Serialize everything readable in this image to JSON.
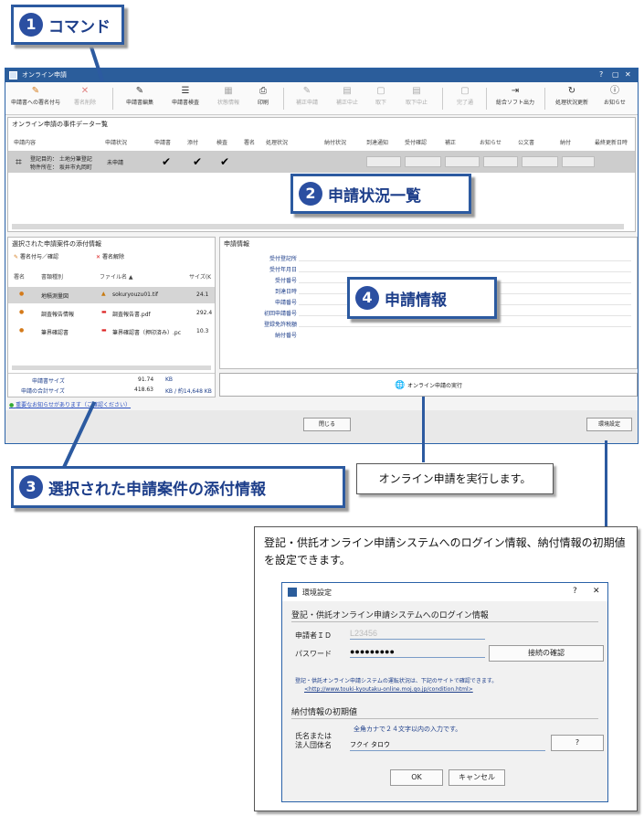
{
  "callouts": {
    "c1": {
      "num": "1",
      "label": "コマンド"
    },
    "c2": {
      "num": "2",
      "label": "申請状況一覧"
    },
    "c3": {
      "num": "3",
      "label": "選択された申請案件の添付情報"
    },
    "c4": {
      "num": "4",
      "label": "申請情報"
    }
  },
  "exec_note": "オンライン申請を実行します。",
  "settings_note": "登記・供託オンライン申請システムへのログイン情報、納付情報の初期値を設定できます。",
  "window": {
    "title": "オンライン申請",
    "controls": [
      "?",
      "▢",
      "✕"
    ],
    "toolbar": [
      {
        "label": "申請書への署名付与",
        "glyph": "✎",
        "enabled": true
      },
      {
        "label": "署名削除",
        "glyph": "✕",
        "enabled": false
      },
      {
        "label": "申請書編集",
        "glyph": "✎",
        "enabled": true
      },
      {
        "label": "申請書検査",
        "glyph": "☰",
        "enabled": true
      },
      {
        "label": "状態情報",
        "glyph": "▦",
        "enabled": false
      },
      {
        "label": "印刷",
        "glyph": "⎙",
        "enabled": true
      },
      {
        "label": "補正申請",
        "glyph": "✎",
        "enabled": false
      },
      {
        "label": "補正中止",
        "glyph": "▤",
        "enabled": false
      },
      {
        "label": "取下",
        "glyph": "▢",
        "enabled": false
      },
      {
        "label": "取下中止",
        "glyph": "▤",
        "enabled": false
      },
      {
        "label": "完了通",
        "glyph": "▢",
        "enabled": false
      },
      {
        "label": "総合ソフト出力",
        "glyph": "⇥",
        "enabled": true
      },
      {
        "label": "処理状況更新",
        "glyph": "↻",
        "enabled": true
      },
      {
        "label": "お知らせ",
        "glyph": "ⓘ",
        "enabled": true
      }
    ],
    "case_list": {
      "title": "オンライン申請の事件データー覧",
      "headers": [
        "申請内容",
        "申請状況",
        "申請書",
        "添付",
        "検査",
        "署名",
        "処理状況",
        "納付状況",
        "到達通知",
        "受付確認",
        "補正",
        "お知らせ",
        "公文書",
        "納付",
        "最終更新日時"
      ],
      "row": {
        "line1": "登記目的： 土地分筆登記",
        "line2": "物件所在： 坂井市丸岡町",
        "status": "未申請",
        "checks": [
          "✔",
          "✔",
          "✔"
        ]
      }
    },
    "attachments": {
      "title": "選択された申請案件の添付情報",
      "sign_button": "署名付与／確認",
      "unsign_button": "署名解除",
      "headers": [
        "署名",
        "書類種別",
        "ファイル名 ▲",
        "サイズ(K"
      ],
      "rows": [
        {
          "type": "地積測量図",
          "file": "sokuryouzu01.tif",
          "size": "24.1"
        },
        {
          "type": "調査報告情報",
          "file": "調査報告書.pdf",
          "size": "292.4"
        },
        {
          "type": "筆界確認書",
          "file": "筆界確認書（押印済み）.pc",
          "size": "10.3"
        }
      ],
      "summary": [
        {
          "label": "申請書サイズ",
          "value": "91.74",
          "unit": "KB"
        },
        {
          "label": "申請の合計サイズ",
          "value": "418.63",
          "unit": "KB / 約14,648 KB"
        }
      ],
      "footer_link": "重要なお知らせがあります（ご確認ください）"
    },
    "info": {
      "title": "申請情報",
      "labels": [
        "受付登記所",
        "受付年月日",
        "受付番号",
        "到達日時",
        "申請番号",
        "初回申請番号",
        "登録免許税額",
        "納付番号"
      ]
    },
    "exec_button": "オンライン申請の実行",
    "close_button": "閉じる",
    "settings_button": "環境設定"
  },
  "dialog": {
    "title": "環境設定",
    "controls": [
      "?",
      "✕"
    ],
    "login_section": "登記・供託オンライン申請システムへのログイン情報",
    "user_id_label": "申請者ＩＤ",
    "user_id_value": "L23456",
    "password_label": "パスワード",
    "password_value": "●●●●●●●●●",
    "connect_button": "接続の確認",
    "status_note": "登記・供託オンライン申請システムの運転状況は、下記のサイトで確認できます。",
    "status_url": "<http://www.touki-kyoutaku-online.moj.go.jp/condition.html>",
    "payment_section": "納付情報の初期値",
    "name_label_1": "氏名または",
    "name_label_2": "法人団体名",
    "name_hint": "全角カナで２４文字以内の入力です。",
    "name_value": "フクイ タロウ",
    "help_button": "?",
    "ok_button": "OK",
    "cancel_button": "キャンセル"
  }
}
